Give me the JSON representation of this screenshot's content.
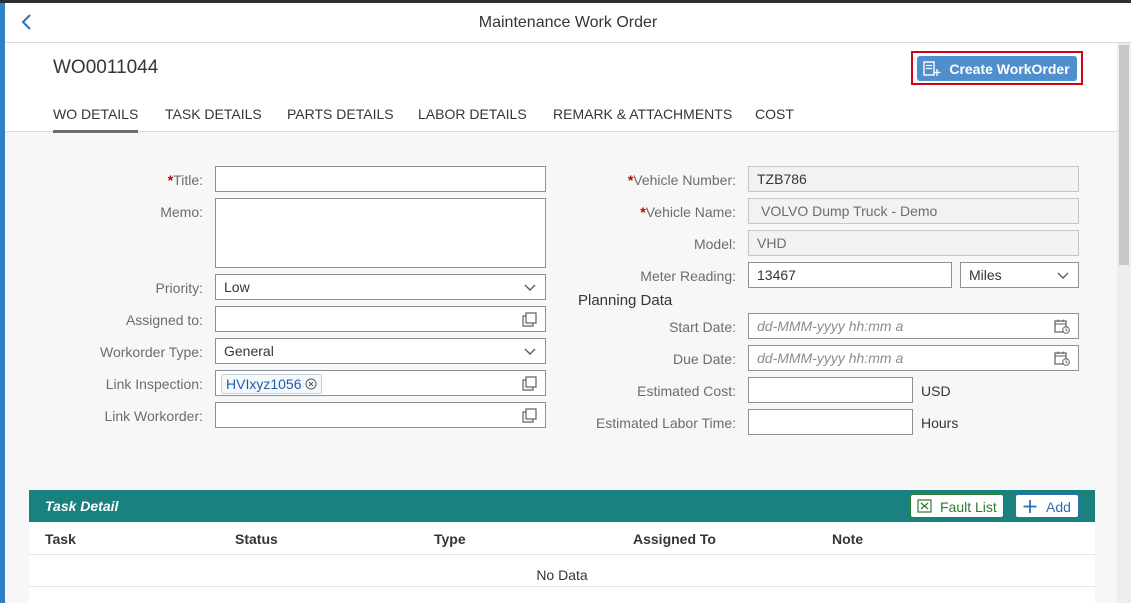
{
  "shell": {
    "title": "Maintenance Work Order"
  },
  "header": {
    "wo_id": "WO0011044",
    "create_button": "Create WorkOrder",
    "tabs": [
      "WO DETAILS",
      "TASK DETAILS",
      "PARTS DETAILS",
      "LABOR DETAILS",
      "REMARK & ATTACHMENTS",
      "COST"
    ],
    "active_tab": "WO DETAILS"
  },
  "form_left": {
    "title_label": "Title:",
    "memo_label": "Memo:",
    "priority_label": "Priority:",
    "priority_value": "Low",
    "assigned_label": "Assigned to:",
    "wo_type_label": "Workorder Type:",
    "wo_type_value": "General",
    "link_inspection_label": "Link Inspection:",
    "link_inspection_token": "HVIxyz1056",
    "link_workorder_label": "Link Workorder:"
  },
  "form_right": {
    "vehicle_number_label": "Vehicle Number:",
    "vehicle_number_value": "TZB786",
    "vehicle_name_label": "Vehicle Name:",
    "vehicle_name_value": "VOLVO Dump Truck - Demo",
    "model_label": "Model:",
    "model_value": "VHD",
    "meter_label": "Meter Reading:",
    "meter_value": "13467",
    "meter_unit": "Miles",
    "planning_title": "Planning Data",
    "start_label": "Start Date:",
    "start_placeholder": "dd-MMM-yyyy hh:mm a",
    "due_label": "Due Date:",
    "due_placeholder": "dd-MMM-yyyy hh:mm a",
    "est_cost_label": "Estimated Cost:",
    "est_cost_unit": "USD",
    "est_labor_label": "Estimated Labor Time:",
    "est_labor_unit": "Hours"
  },
  "task_detail": {
    "title": "Task Detail",
    "fault_list_button": "Fault List",
    "add_button": "Add",
    "columns": [
      "Task",
      "Status",
      "Type",
      "Assigned To",
      "Note"
    ],
    "empty_text": "No Data"
  },
  "colors": {
    "accent": "#4f8fcd",
    "task_bar": "#19827f",
    "required": "#bb0000",
    "highlight_border": "#d0021b"
  }
}
